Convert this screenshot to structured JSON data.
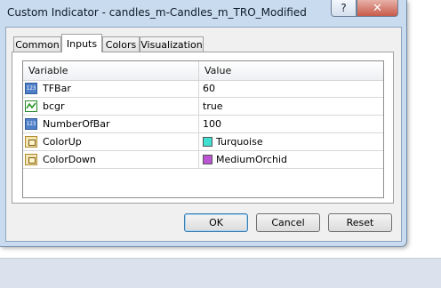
{
  "window": {
    "title": "Custom Indicator - candles_m-Candles_m_TRO_Modified",
    "help_label": "?",
    "close_label": "✕"
  },
  "tabs": [
    {
      "label": "Common",
      "active": false
    },
    {
      "label": "Inputs",
      "active": true
    },
    {
      "label": "Colors",
      "active": false
    },
    {
      "label": "Visualization",
      "active": false
    }
  ],
  "grid": {
    "headers": {
      "variable": "Variable",
      "value": "Value"
    },
    "rows": [
      {
        "icon": "number-icon",
        "name": "TFBar",
        "value": "60"
      },
      {
        "icon": "boolean-icon",
        "name": "bcgr",
        "value": "true"
      },
      {
        "icon": "number-icon",
        "name": "NumberOfBar",
        "value": "100"
      },
      {
        "icon": "color-icon",
        "name": "ColorUp",
        "value": "Turquoise",
        "swatch": "#40e0d0"
      },
      {
        "icon": "color-icon",
        "name": "ColorDown",
        "value": "MediumOrchid",
        "swatch": "#ba55d3"
      }
    ]
  },
  "buttons": {
    "ok": "OK",
    "cancel": "Cancel",
    "reset": "Reset"
  }
}
